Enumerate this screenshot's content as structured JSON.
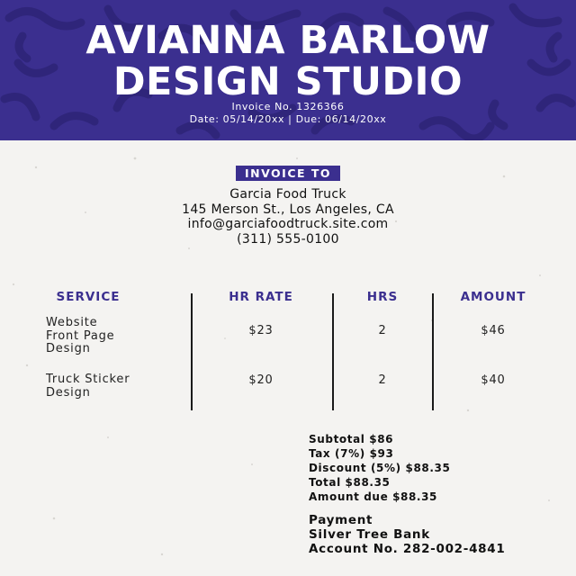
{
  "header": {
    "studio_line1": "AVIANNA BARLOW",
    "studio_line2": "DESIGN STUDIO",
    "invoice_number": "Invoice No. 1326366",
    "dates": "Date: 05/14/20xx | Due: 06/14/20xx",
    "background_color": "#3b2f8f"
  },
  "invoice_to": {
    "badge_label": "INVOICE TO",
    "name": "Garcia Food Truck",
    "address": "145 Merson St., Los Angeles, CA",
    "email": "info@garciafoodtruck.site.com",
    "phone": "(311) 555-0100"
  },
  "table": {
    "headers": [
      "SERVICE",
      "HR RATE",
      "HRS",
      "AMOUNT"
    ],
    "rows": [
      {
        "service_lines": [
          "Website",
          "Front Page",
          "Design"
        ],
        "rate": "$23",
        "hrs": "2",
        "amount": "$46"
      },
      {
        "service_lines": [
          "Truck Sticker",
          "Design"
        ],
        "rate": "$20",
        "hrs": "2",
        "amount": "$40"
      }
    ]
  },
  "totals": {
    "subtotal": "Subtotal $86",
    "tax": "Tax (7%) $93",
    "discount": "Discount (5%) $88.35",
    "total": "Total $88.35",
    "amount_due": "Amount due $88.35"
  },
  "payment": {
    "heading": "Payment",
    "bank": "Silver Tree Bank",
    "account": "Account No. 282-002-4841"
  },
  "colors": {
    "accent": "#3b2f8f",
    "paper": "#f4f3f1",
    "text": "#111111"
  }
}
